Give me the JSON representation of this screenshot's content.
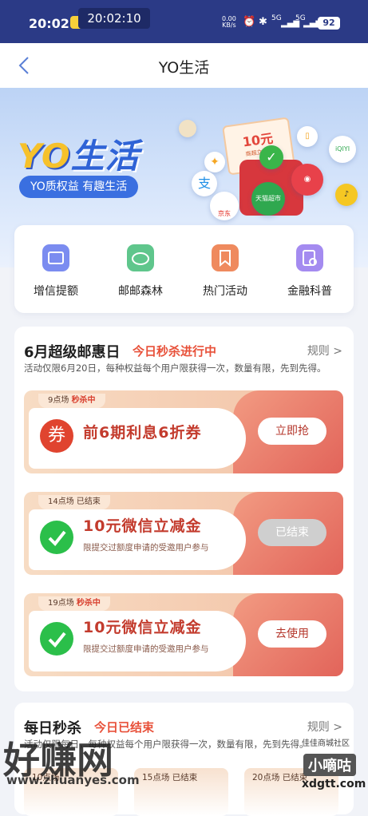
{
  "status_bar": {
    "time": "20:02",
    "clock_overlay": "20:02:10",
    "net_speed_value": "0.00",
    "net_speed_unit": "KB/s",
    "signal1": "5G",
    "signal2": "5G",
    "battery": "92"
  },
  "nav": {
    "title": "YO生活"
  },
  "banner": {
    "logo_latin": "YO",
    "logo_cn": "生活",
    "slogan": "YO质权益 有趣生活",
    "coupon_amount": "10元",
    "coupon_sub": "商超立减金",
    "bubble_jd": "京东",
    "bubble_tmall": "天猫超市",
    "bubble_iqiyi": "iQIYI",
    "bubble_alipay": "支"
  },
  "quick_links": [
    {
      "label": "增信提额",
      "icon": "wallet-icon",
      "color": "#7b8cf0"
    },
    {
      "label": "邮邮森林",
      "icon": "co2-cloud-icon",
      "color": "#5fc68c"
    },
    {
      "label": "热门活动",
      "icon": "bookmark-icon",
      "color": "#ef8a5e"
    },
    {
      "label": "金融科普",
      "icon": "magnify-doc-icon",
      "color": "#a48bf0"
    }
  ],
  "section1": {
    "title": "6月超级邮惠日",
    "status": "今日秒杀进行中",
    "rule": "规则 >",
    "desc": "活动仅限6月20日，每种权益每个用户限获得一次，数量有限，先到先得。",
    "deals": [
      {
        "slot": "9点场",
        "slot_status": "秒杀中",
        "title": "前6期利息6折券",
        "subtitle": "",
        "button": "立即抢",
        "done": false,
        "icon": "coupon-icon"
      },
      {
        "slot": "14点场",
        "slot_status": "已结束",
        "title": "10元微信立减金",
        "subtitle": "限提交过额度申请的受邀用户参与",
        "button": "已结束",
        "done": true,
        "icon": "wechat-icon"
      },
      {
        "slot": "19点场",
        "slot_status": "秒杀中",
        "title": "10元微信立减金",
        "subtitle": "限提交过额度申请的受邀用户参与",
        "button": "去使用",
        "done": false,
        "icon": "wechat-icon"
      }
    ]
  },
  "section2": {
    "title": "每日秒杀",
    "status": "今日已结束",
    "rule": "规则 >",
    "desc_partial": "活动仅限每日，每种权益每个用户限获得一次，数量有限，先到先得。",
    "slots": [
      "10点场",
      "15点场 已结束",
      "20点场 已结束"
    ]
  },
  "watermark": {
    "left_big": "好赚网",
    "left_url": "www.zhuanyes.com",
    "right_small": "佳佳商城社区",
    "right_brand": "小嘀咕",
    "right_url": "xdgtt.com"
  }
}
